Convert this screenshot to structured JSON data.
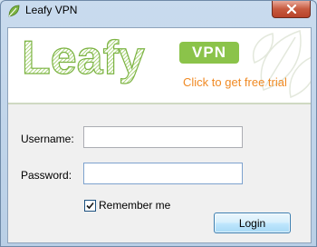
{
  "window": {
    "title": "Leafy VPN",
    "close_symbol": "✕"
  },
  "banner": {
    "logo_text": "Leafy",
    "badge_text": "VPN",
    "promo_text": "Click to get free trial",
    "brand_green": "#8bc34a",
    "promo_color": "#f08a24"
  },
  "form": {
    "username_label": "Username:",
    "username_value": "",
    "password_label": "Password:",
    "password_value": "",
    "remember_label": "Remember me",
    "remember_checked": true,
    "login_label": "Login"
  }
}
